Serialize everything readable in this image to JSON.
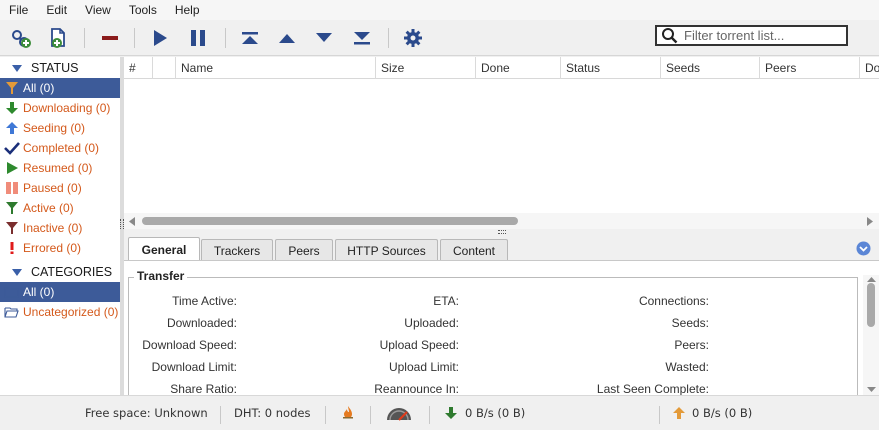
{
  "menu": [
    "File",
    "Edit",
    "View",
    "Tools",
    "Help"
  ],
  "filter": {
    "placeholder": "Filter torrent list..."
  },
  "sidebar": {
    "status_title": "STATUS",
    "status_items": [
      {
        "label": "All (0)",
        "icon": "all-filter-icon"
      },
      {
        "label": "Downloading (0)",
        "icon": "download-arrow-icon"
      },
      {
        "label": "Seeding (0)",
        "icon": "upload-arrow-icon"
      },
      {
        "label": "Completed (0)",
        "icon": "checkmark-icon"
      },
      {
        "label": "Resumed (0)",
        "icon": "play-icon"
      },
      {
        "label": "Paused (0)",
        "icon": "pause-icon"
      },
      {
        "label": "Active (0)",
        "icon": "active-filter-icon"
      },
      {
        "label": "Inactive (0)",
        "icon": "inactive-filter-icon"
      },
      {
        "label": "Errored (0)",
        "icon": "error-icon"
      }
    ],
    "categories_title": "CATEGORIES",
    "category_items": [
      {
        "label": "All (0)",
        "icon": "folder-icon"
      },
      {
        "label": "Uncategorized (0)",
        "icon": "folder-open-icon"
      }
    ]
  },
  "table": {
    "columns": [
      "#",
      "",
      "Name",
      "Size",
      "Done",
      "Status",
      "Seeds",
      "Peers",
      "Do"
    ]
  },
  "tabs": [
    "General",
    "Trackers",
    "Peers",
    "HTTP Sources",
    "Content"
  ],
  "transfer": {
    "title": "Transfer",
    "col1": [
      "Time Active:",
      "Downloaded:",
      "Download Speed:",
      "Download Limit:",
      "Share Ratio:"
    ],
    "col2": [
      "ETA:",
      "Uploaded:",
      "Upload Speed:",
      "Upload Limit:",
      "Reannounce In:"
    ],
    "col3": [
      "Connections:",
      "Seeds:",
      "Peers:",
      "Wasted:",
      "Last Seen Complete:"
    ]
  },
  "status": {
    "free_space": "Free space: Unknown",
    "dht": "DHT: 0 nodes",
    "download": "0 B/s (0 B)",
    "upload": "0 B/s (0 B)"
  },
  "colors": {
    "accent": "#3d5b99",
    "orange": "#d4591b",
    "blue_icon": "#2b4a8c"
  }
}
